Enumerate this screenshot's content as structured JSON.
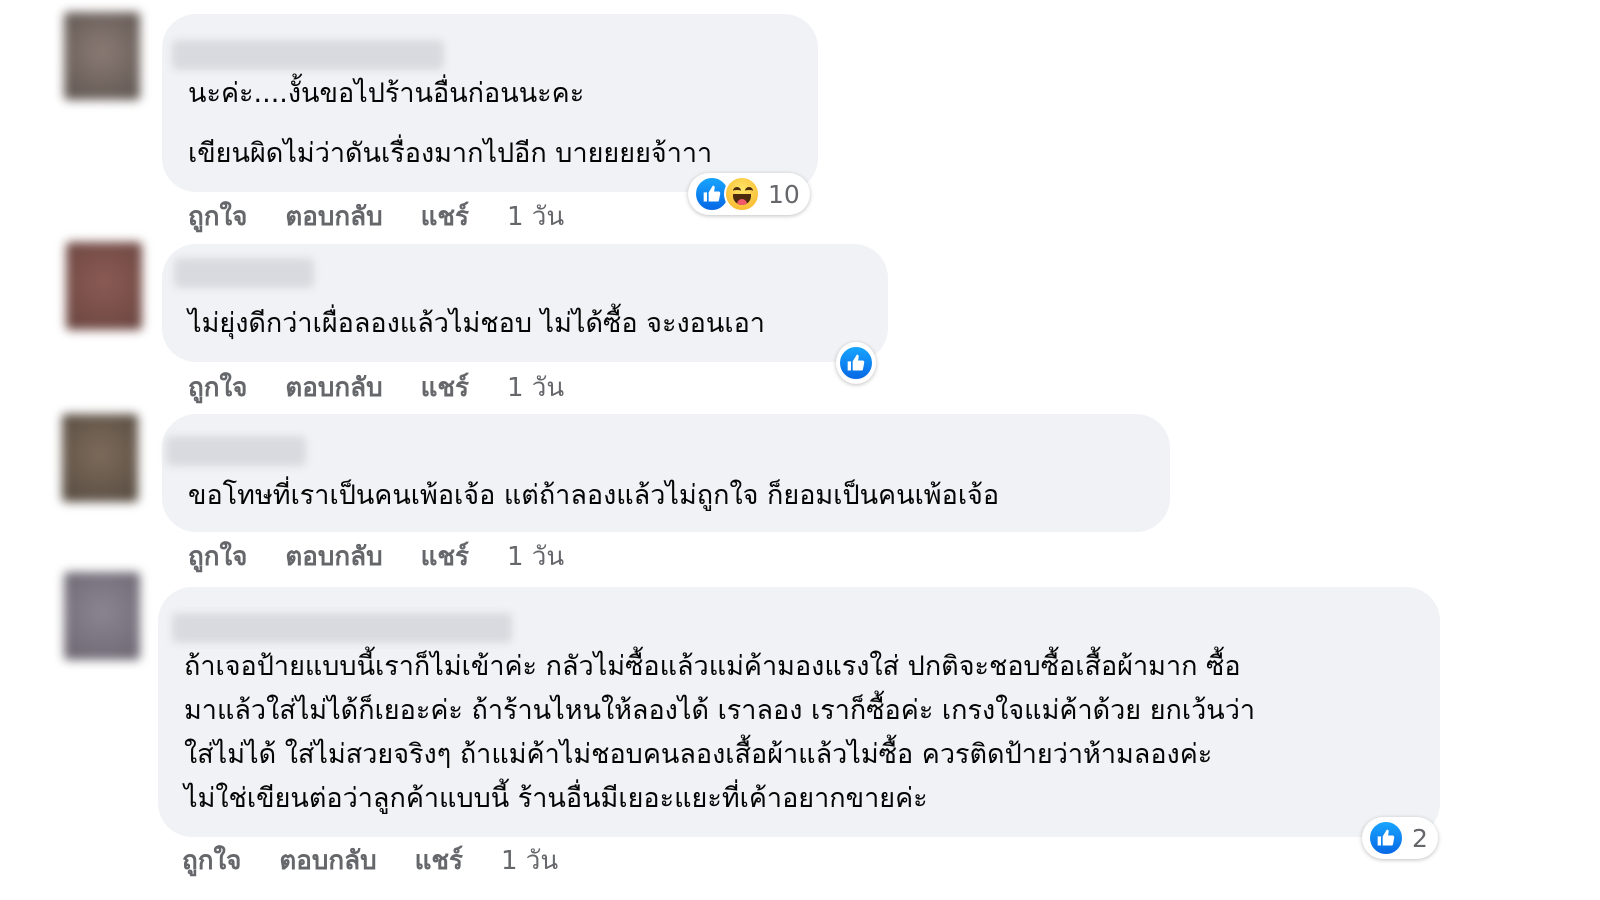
{
  "actions": {
    "like": "ถูกใจ",
    "reply": "ตอบกลับ",
    "share": "แชร์"
  },
  "comments": [
    {
      "lines": [
        "นะค่ะ....งั้นขอไปร้านอื่นก่อนนะคะ",
        "เขียนผิดไม่ว่าดันเรื่องมากไปอีก บายยยยจ้าาา"
      ],
      "time": "1 วัน",
      "reactions": {
        "icons": [
          "like-icon",
          "haha-icon"
        ],
        "count": "10"
      }
    },
    {
      "lines": [
        "ไม่ยุ่งดีกว่าเผื่อลองแล้วไม่ชอบ ไม่ได้ซื้อ จะงอนเอา"
      ],
      "time": "1 วัน",
      "reactions": {
        "icons": [
          "like-icon"
        ],
        "count": ""
      }
    },
    {
      "lines": [
        "ขอโทษที่เราเป็นคนเพ้อเจ้อ แต่ถ้าลองแล้วไม่ถูกใจ ก็ยอมเป็นคนเพ้อเจ้อ"
      ],
      "time": "1 วัน",
      "reactions": null
    },
    {
      "lines": [
        "ถ้าเจอป้ายแบบนี้เราก็ไม่เข้าค่ะ กลัวไม่ซื้อแล้วแม่ค้ามองแรงใส่ ปกติจะชอบซื้อเสื้อผ้ามาก ซื้อ",
        "มาแล้วใส่ไม่ได้ก็เยอะค่ะ ถ้าร้านไหนให้ลองได้ เราลอง เราก็ซื้อค่ะ เกรงใจแม่ค้าด้วย ยกเว้นว่า",
        "ใส่ไม่ได้ ใส่ไม่สวยจริงๆ ถ้าแม่ค้าไม่ชอบคนลองเสื้อผ้าแล้วไม่ซื้อ ควรติดป้ายว่าห้ามลองค่ะ",
        "ไม่ใช่เขียนต่อว่าลูกค้าแบบนี้ ร้านอื่นมีเยอะแยะที่เค้าอยากขายค่ะ"
      ],
      "time": "1 วัน",
      "reactions": {
        "icons": [
          "like-icon"
        ],
        "count": "2"
      }
    }
  ]
}
